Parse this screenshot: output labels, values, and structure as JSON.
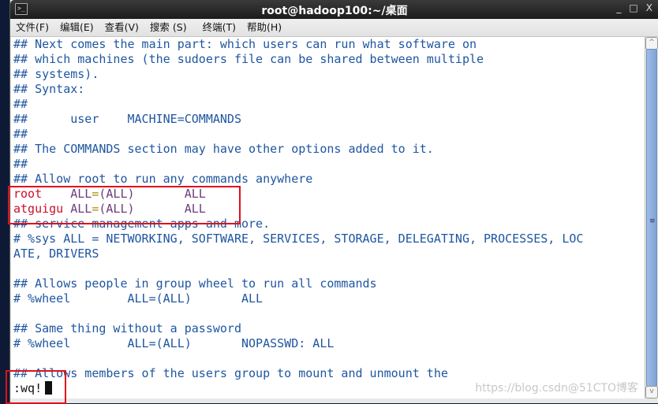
{
  "window": {
    "title": "root@hadoop100:~/桌面",
    "icon": "terminal-icon",
    "controls": {
      "minimize": "_",
      "maximize": "□",
      "close": "X"
    }
  },
  "menu": [
    {
      "label": "文件(F)"
    },
    {
      "label": "编辑(E)"
    },
    {
      "label": "查看(V)"
    },
    {
      "label": "搜索 (S)"
    },
    {
      "label": "终端(T)"
    },
    {
      "label": "帮助(H)"
    }
  ],
  "terminal": {
    "lines": [
      {
        "hash": "##",
        "text": " Next comes the main part: which users can run what software on"
      },
      {
        "hash": "##",
        "text": " which machines (the sudoers file can be shared between multiple"
      },
      {
        "hash": "##",
        "text": " systems)."
      },
      {
        "hash": "##",
        "text": " Syntax:"
      },
      {
        "hash": "##",
        "text": ""
      },
      {
        "hash": "##",
        "text": "      user    MACHINE=COMMANDS"
      },
      {
        "hash": "##",
        "text": ""
      },
      {
        "hash": "##",
        "text": " The COMMANDS section may have other options added to it."
      },
      {
        "hash": "##",
        "text": ""
      },
      {
        "hash": "##",
        "text": " Allow root to run any commands anywhere"
      }
    ],
    "rules": [
      {
        "user": "root   ",
        "host": " ALL",
        "eq": "=",
        "runas": "(ALL)",
        "cmd": "       ALL"
      },
      {
        "user": "atguigu",
        "host": " ALL",
        "eq": "=",
        "runas": "(ALL)",
        "cmd": "       ALL"
      }
    ],
    "lines2": [
      {
        "hash": "##",
        "text": " service management apps and more."
      },
      {
        "hash": "#",
        "text": " %sys ALL = NETWORKING, SOFTWARE, SERVICES, STORAGE, DELEGATING, PROCESSES, LOC"
      },
      {
        "hash": "",
        "text": "ATE, DRIVERS"
      },
      {
        "hash": "",
        "text": ""
      },
      {
        "hash": "##",
        "text": " Allows people in group wheel to run all commands"
      },
      {
        "hash": "#",
        "text": " %wheel        ALL=(ALL)       ALL"
      },
      {
        "hash": "",
        "text": ""
      },
      {
        "hash": "##",
        "text": " Same thing without a password"
      },
      {
        "hash": "#",
        "text": " %wheel        ALL=(ALL)       NOPASSWD: ALL"
      },
      {
        "hash": "",
        "text": ""
      },
      {
        "hash": "##",
        "text": " Allows members of the users group to mount and unmount the"
      }
    ],
    "command_line": ":wq!"
  },
  "watermark": "https://blog.csdn@51CTO博客"
}
